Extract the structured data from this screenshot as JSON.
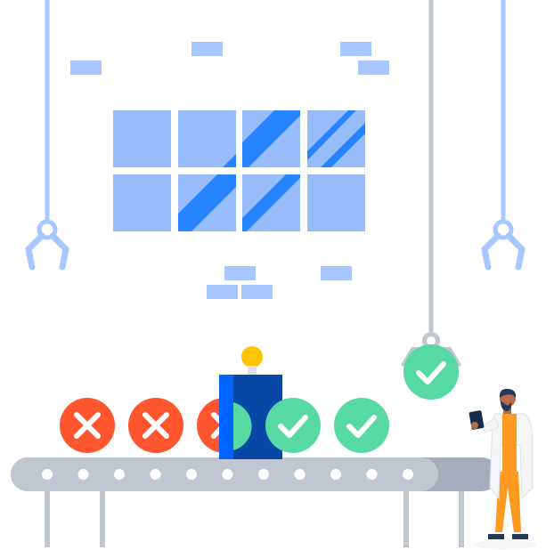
{
  "scene": {
    "colors": {
      "window_light": "#97bcfb",
      "window_dark": "#2684ff",
      "brick": "#a6c8ff",
      "claw": "#a6c8ff",
      "cable_gray": "#c1c7d0",
      "belt_gray": "#c1c7d0",
      "belt_dark": "#a5adba",
      "belt_dot": "#ffffff",
      "reject_red": "#ff5630",
      "accept_green": "#57d9a3",
      "scanner_blue": "#0747a6",
      "scanner_side": "#0065ff",
      "bulb_yellow": "#ffc400",
      "coat_white": "#f4f5f7",
      "vest_orange": "#ff991f",
      "skin": "#b86b4b",
      "hair": "#253858",
      "tablet": "#172b4d"
    },
    "icons": [
      "close-icon",
      "check-icon",
      "light-bulb-icon",
      "robot-claw-icon",
      "tablet-icon"
    ],
    "items_rejected": 3,
    "items_approved": 3
  }
}
